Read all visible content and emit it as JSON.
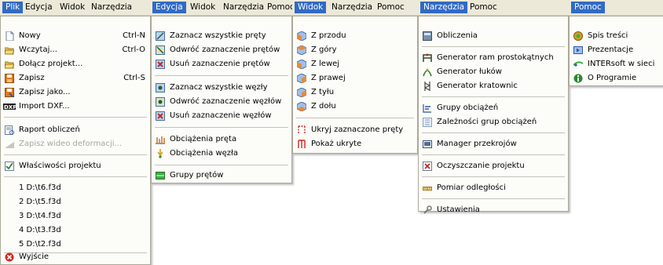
{
  "panels": [
    {
      "menubar": [
        "Plik",
        "Edycja",
        "Widok",
        "Narzędzia"
      ],
      "items": [
        {
          "label": "Nowy",
          "shortcut": "Ctrl-N",
          "icon": "new-document-icon"
        },
        {
          "label": "Wczytaj...",
          "shortcut": "Ctrl-O",
          "icon": "open-folder-icon"
        },
        {
          "label": "Dołącz projekt...",
          "icon": "append-project-icon"
        },
        {
          "label": "Zapisz",
          "shortcut": "Ctrl-S",
          "icon": "save-icon"
        },
        {
          "label": "Zapisz jako...",
          "icon": "save-as-icon"
        },
        {
          "label": "Import DXF...",
          "icon": "dxf-icon"
        },
        {
          "label": "Raport obliczeń",
          "icon": "report-icon"
        },
        {
          "label": "Zapisz wideo deformacji...",
          "icon": "video-icon",
          "disabled": true
        },
        {
          "label": "Właściwości projektu",
          "icon": "properties-icon"
        },
        {
          "label": "1 D:\\t6.f3d"
        },
        {
          "label": "2 D:\\t5.f3d"
        },
        {
          "label": "3 D:\\t4.f3d"
        },
        {
          "label": "4 D:\\t3.f3d"
        },
        {
          "label": "5 D:\\t2.f3d"
        },
        {
          "label": "Wyjście",
          "icon": "exit-icon"
        }
      ]
    },
    {
      "menubar": [
        "Edycja",
        "Widok",
        "Narzędzia",
        "Pomoc"
      ],
      "items": [
        {
          "label": "Zaznacz wszystkie pręty",
          "icon": "select-all-bars-icon"
        },
        {
          "label": "Odwróć zaznaczenie prętów",
          "icon": "invert-bars-icon"
        },
        {
          "label": "Usuń zaznaczenie prętów",
          "icon": "deselect-bars-icon"
        },
        {
          "label": "Zaznacz wszystkie węzły",
          "icon": "select-all-nodes-icon"
        },
        {
          "label": "Odwróć zaznaczenie węzłów",
          "icon": "invert-nodes-icon"
        },
        {
          "label": "Usuń zaznaczenie węzłów",
          "icon": "deselect-nodes-icon"
        },
        {
          "label": "Obciążenia pręta",
          "icon": "bar-load-icon"
        },
        {
          "label": "Obciążenia węzła",
          "icon": "node-load-icon"
        },
        {
          "label": "Grupy prętów",
          "icon": "bar-groups-icon"
        }
      ]
    },
    {
      "menubar": [
        "Widok",
        "Narzędzia",
        "Pomoc"
      ],
      "items": [
        {
          "label": "Z przodu",
          "icon": "view-front-icon"
        },
        {
          "label": "Z góry",
          "icon": "view-top-icon"
        },
        {
          "label": "Z lewej",
          "icon": "view-left-icon"
        },
        {
          "label": "Z prawej",
          "icon": "view-right-icon"
        },
        {
          "label": "Z tyłu",
          "icon": "view-back-icon"
        },
        {
          "label": "Z dołu",
          "icon": "view-bottom-icon"
        },
        {
          "label": "Ukryj zaznaczone pręty",
          "icon": "hide-bars-icon"
        },
        {
          "label": "Pokaż ukryte",
          "icon": "show-hidden-icon"
        }
      ]
    },
    {
      "menubar": [
        "Narzędzia",
        "Pomoc"
      ],
      "items": [
        {
          "label": "Obliczenia",
          "icon": "calculator-icon"
        },
        {
          "label": "Generator ram prostokątnych",
          "icon": "frame-generator-icon"
        },
        {
          "label": "Generator łuków",
          "icon": "arc-generator-icon"
        },
        {
          "label": "Generator kratownic",
          "icon": "truss-generator-icon"
        },
        {
          "label": "Grupy obciążeń",
          "icon": "load-groups-icon"
        },
        {
          "label": "Zależności grup obciążeń",
          "icon": "load-dependencies-icon"
        },
        {
          "label": "Manager przekrojów",
          "icon": "section-manager-icon"
        },
        {
          "label": "Oczyszczanie projektu",
          "icon": "cleanup-icon"
        },
        {
          "label": "Pomiar odległości",
          "icon": "ruler-icon"
        },
        {
          "label": "Ustawienia",
          "icon": "settings-icon"
        }
      ]
    },
    {
      "menubar": [
        "Pomoc"
      ],
      "items": [
        {
          "label": "Spis treści",
          "icon": "help-contents-icon"
        },
        {
          "label": "Prezentacje",
          "icon": "presentations-icon"
        },
        {
          "label": "INTERsoft w sieci",
          "icon": "web-icon"
        },
        {
          "label": "O Programie",
          "icon": "about-icon"
        }
      ]
    }
  ]
}
